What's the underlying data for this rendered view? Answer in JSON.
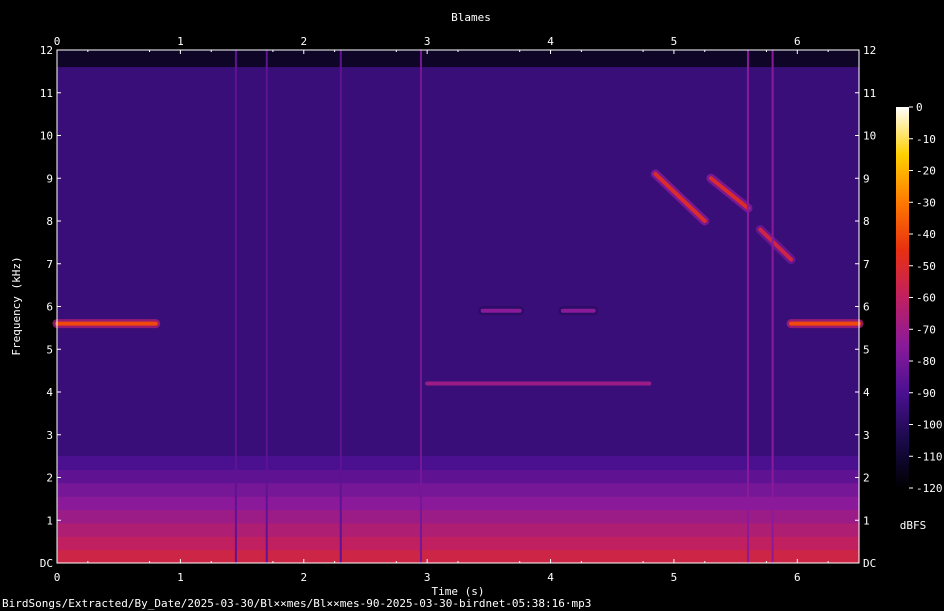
{
  "title": "Blames",
  "filename": "BirdSongs/Extracted/By_Date/2025-03-30/Bl××mes/Bl××mes-90-2025-03-30-birdnet-05:38:16·mp3",
  "chart_data": {
    "type": "heatmap",
    "title": "Blames",
    "xlabel": "Time (s)",
    "ylabel": "Frequency (kHz)",
    "xlim": [
      0,
      6.5
    ],
    "ylim": [
      0,
      12
    ],
    "x_ticks": [
      "0",
      "1",
      "2",
      "3",
      "4",
      "5",
      "6"
    ],
    "y_ticks": [
      "DC",
      "1",
      "2",
      "3",
      "4",
      "5",
      "6",
      "7",
      "8",
      "9",
      "10",
      "11",
      "12"
    ],
    "colorbar": {
      "label": "dBFS",
      "range": [
        -120,
        0
      ],
      "ticks": [
        "0",
        "-10",
        "-20",
        "-30",
        "-40",
        "-50",
        "-60",
        "-70",
        "-80",
        "-90",
        "-100",
        "-110",
        "-120"
      ],
      "colors": [
        "#000000",
        "#1a0a4a",
        "#4a1090",
        "#8a1a9a",
        "#c02060",
        "#e83010",
        "#ff7a00",
        "#ffd000",
        "#ffffff"
      ]
    },
    "features": [
      {
        "kind": "tone",
        "t": [
          0,
          0.8
        ],
        "f": [
          5.6,
          5.6
        ],
        "level_db": -40
      },
      {
        "kind": "tone",
        "t": [
          5.95,
          6.5
        ],
        "f": [
          5.6,
          5.6
        ],
        "level_db": -40
      },
      {
        "kind": "sweep",
        "t": [
          4.85,
          5.25
        ],
        "f": [
          9.1,
          8.0
        ],
        "level_db": -50
      },
      {
        "kind": "sweep",
        "t": [
          5.3,
          5.6
        ],
        "f": [
          9.0,
          8.3
        ],
        "level_db": -50
      },
      {
        "kind": "sweep",
        "t": [
          5.7,
          5.95
        ],
        "f": [
          7.8,
          7.1
        ],
        "level_db": -55
      },
      {
        "kind": "tone",
        "t": [
          3.0,
          4.8
        ],
        "f": [
          4.2,
          4.2
        ],
        "level_db": -70
      },
      {
        "kind": "tone",
        "t": [
          3.45,
          3.75
        ],
        "f": [
          5.9,
          5.9
        ],
        "level_db": -75
      },
      {
        "kind": "tone",
        "t": [
          4.1,
          4.35
        ],
        "f": [
          5.9,
          5.9
        ],
        "level_db": -75
      },
      {
        "kind": "noise",
        "t": [
          0,
          6.5
        ],
        "f": [
          0,
          2.5
        ],
        "level_db": -55
      },
      {
        "kind": "click",
        "t": [
          1.45,
          1.45
        ],
        "f": [
          0,
          12
        ],
        "level_db": -85
      },
      {
        "kind": "click",
        "t": [
          1.7,
          1.7
        ],
        "f": [
          0,
          12
        ],
        "level_db": -85
      },
      {
        "kind": "click",
        "t": [
          2.3,
          2.3
        ],
        "f": [
          0,
          12
        ],
        "level_db": -85
      },
      {
        "kind": "click",
        "t": [
          2.95,
          2.95
        ],
        "f": [
          0,
          12
        ],
        "level_db": -80
      },
      {
        "kind": "click",
        "t": [
          5.6,
          5.6
        ],
        "f": [
          0,
          12
        ],
        "level_db": -75
      },
      {
        "kind": "click",
        "t": [
          5.8,
          5.8
        ],
        "f": [
          0,
          12
        ],
        "level_db": -75
      }
    ],
    "background_level_db": -95,
    "grid": false
  }
}
